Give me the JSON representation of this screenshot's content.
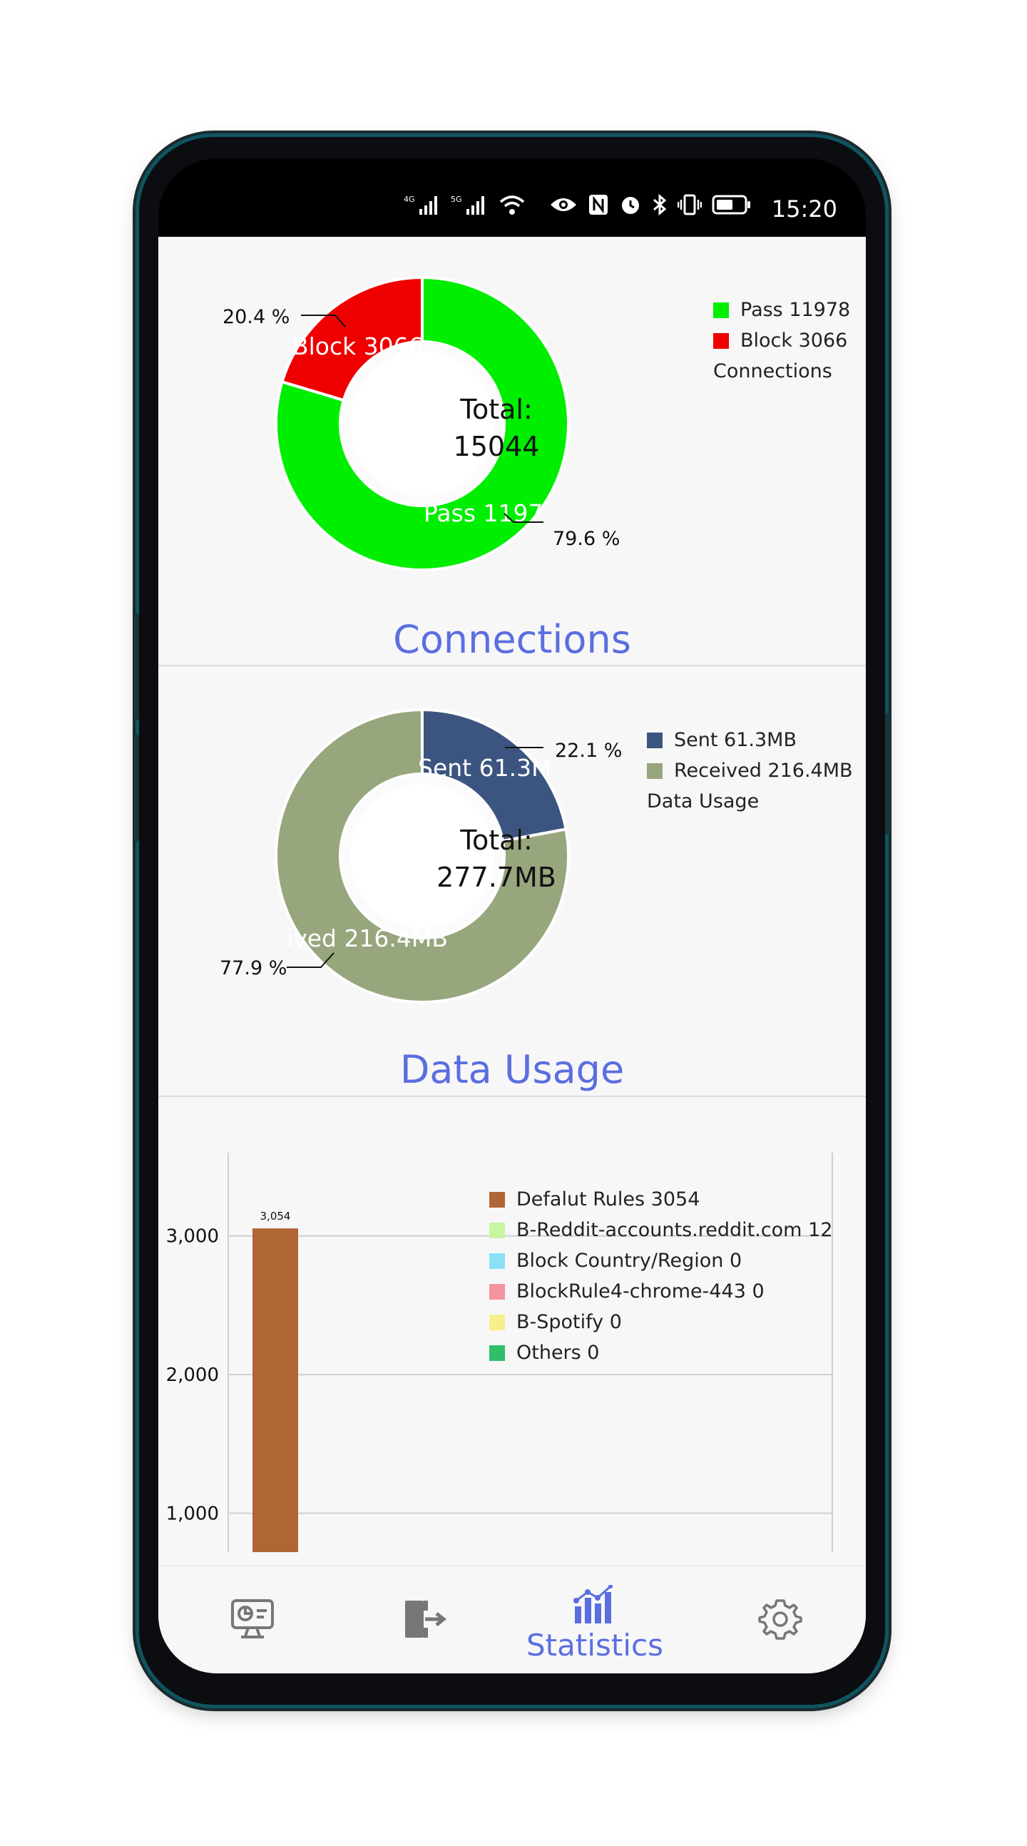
{
  "status_bar": {
    "time": "15:20",
    "icons": [
      "4g-signal-icon",
      "5g-signal-icon",
      "wifi-icon",
      "eye-icon",
      "nfc-icon",
      "alarm-icon",
      "bluetooth-icon",
      "vibrate-icon",
      "battery-icon"
    ],
    "signal_4g": "4G",
    "signal_5g": "5G"
  },
  "connections": {
    "section_title": "Connections",
    "total_label": "Total:",
    "total_value": "15044",
    "legend_caption": "Connections",
    "legend": [
      {
        "label": "Pass 11978",
        "color": "#00ee00"
      },
      {
        "label": "Block 3066",
        "color": "#ee0000"
      }
    ],
    "pct_pass": "79.6 %",
    "pct_block": "20.4 %",
    "slice_label_pass": "Pass 1197",
    "slice_label_block": "Block 3066"
  },
  "data_usage": {
    "section_title": "Data Usage",
    "total_label": "Total:",
    "total_value": "277.7MB",
    "legend_caption": "Data Usage",
    "legend": [
      {
        "label": "Sent 61.3MB",
        "color": "#3c5580"
      },
      {
        "label": "Received 216.4MB",
        "color": "#97a67c"
      }
    ],
    "pct_sent": "22.1 %",
    "pct_received": "77.9 %",
    "slice_label_sent": "Sent 61.3M",
    "slice_label_received": "ived 216.4MB"
  },
  "rules_chart": {
    "legend": [
      {
        "label": "Defalut Rules 3054",
        "color": "#b06535"
      },
      {
        "label": "B-Reddit-accounts.reddit.com 12",
        "color": "#c8f5a0"
      },
      {
        "label": "Block Country/Region 0",
        "color": "#8ce0f5"
      },
      {
        "label": "BlockRule4-chrome-443 0",
        "color": "#f592a0"
      },
      {
        "label": "B-Spotify 0",
        "color": "#f5f08c"
      },
      {
        "label": "Others 0",
        "color": "#2fbf6a"
      }
    ],
    "y_ticks": [
      "3,000",
      "2,000",
      "1,000"
    ],
    "bar_value_label": "3,054"
  },
  "chart_data": [
    {
      "type": "pie",
      "title": "Connections",
      "labels": [
        "Pass",
        "Block"
      ],
      "values": [
        11978,
        3066
      ],
      "percentages": [
        79.6,
        20.4
      ],
      "colors": [
        "#00ee00",
        "#ee0000"
      ],
      "center_text": "Total: 15044",
      "legend_position": "top-right"
    },
    {
      "type": "pie",
      "title": "Data Usage",
      "labels": [
        "Sent",
        "Received"
      ],
      "values": [
        61.3,
        216.4
      ],
      "unit": "MB",
      "percentages": [
        22.1,
        77.9
      ],
      "colors": [
        "#3c5580",
        "#97a67c"
      ],
      "center_text": "Total: 277.7MB",
      "legend_position": "top-right"
    },
    {
      "type": "bar",
      "categories": [
        "Defalut Rules",
        "B-Reddit-accounts.reddit.com",
        "Block Country/Region",
        "BlockRule4-chrome-443",
        "B-Spotify",
        "Others"
      ],
      "values": [
        3054,
        12,
        0,
        0,
        0,
        0
      ],
      "colors": [
        "#b06535",
        "#c8f5a0",
        "#8ce0f5",
        "#f592a0",
        "#f5f08c",
        "#2fbf6a"
      ],
      "y_ticks": [
        1000,
        2000,
        3000
      ],
      "ylim": [
        720,
        3600
      ],
      "grid": true,
      "legend_position": "top-right"
    }
  ],
  "nav": {
    "items": [
      {
        "name": "dashboard",
        "icon": "monitor-icon"
      },
      {
        "name": "exit",
        "icon": "exit-door-icon"
      },
      {
        "name": "statistics",
        "icon": "bar-chart-icon",
        "label": "Statistics",
        "active": true
      },
      {
        "name": "settings",
        "icon": "gear-icon"
      }
    ],
    "active_color": "#5b6ee0"
  }
}
